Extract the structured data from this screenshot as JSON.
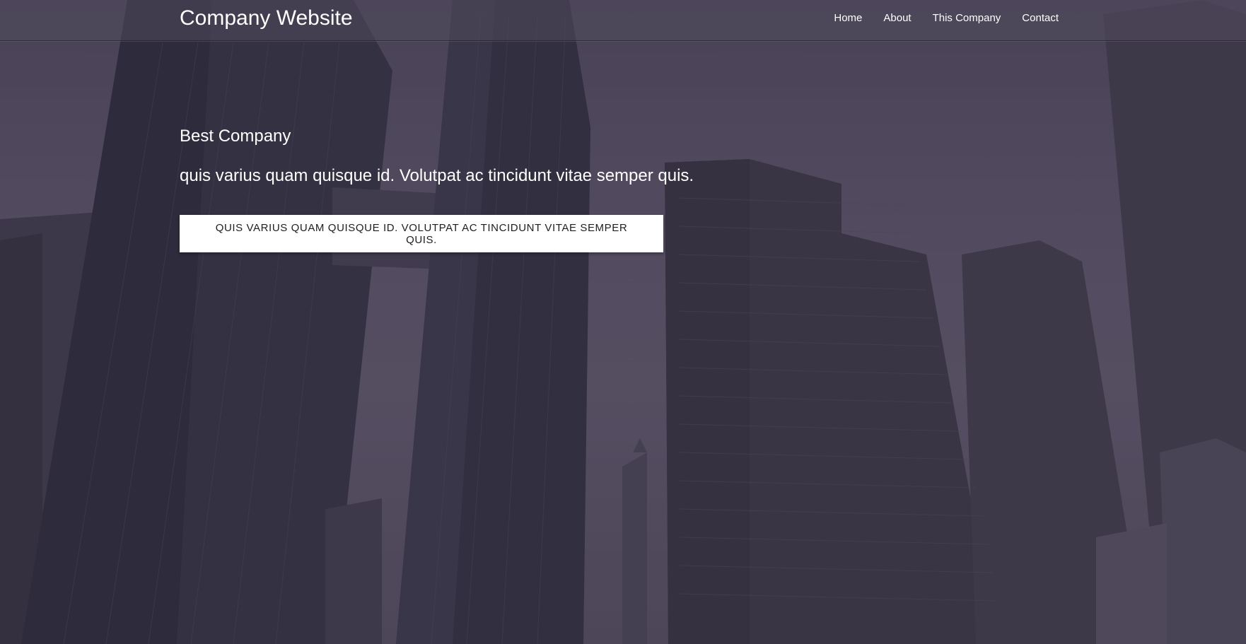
{
  "navbar": {
    "brand": "Company Website",
    "links": [
      {
        "label": "Home"
      },
      {
        "label": "About"
      },
      {
        "label": "This Company"
      },
      {
        "label": "Contact"
      }
    ]
  },
  "hero": {
    "subtitle": "Best Company",
    "tagline": "quis varius quam quisque id. Volutpat ac tincidunt vitae semper quis.",
    "cta_label": "quis varius quam quisque id. Volutpat ac tincidunt vitae semper quis."
  },
  "colors": {
    "text": "#ffffff",
    "cta_background": "#ffffff",
    "cta_text": "#1e1e1e",
    "overlay": "#504b5c"
  }
}
